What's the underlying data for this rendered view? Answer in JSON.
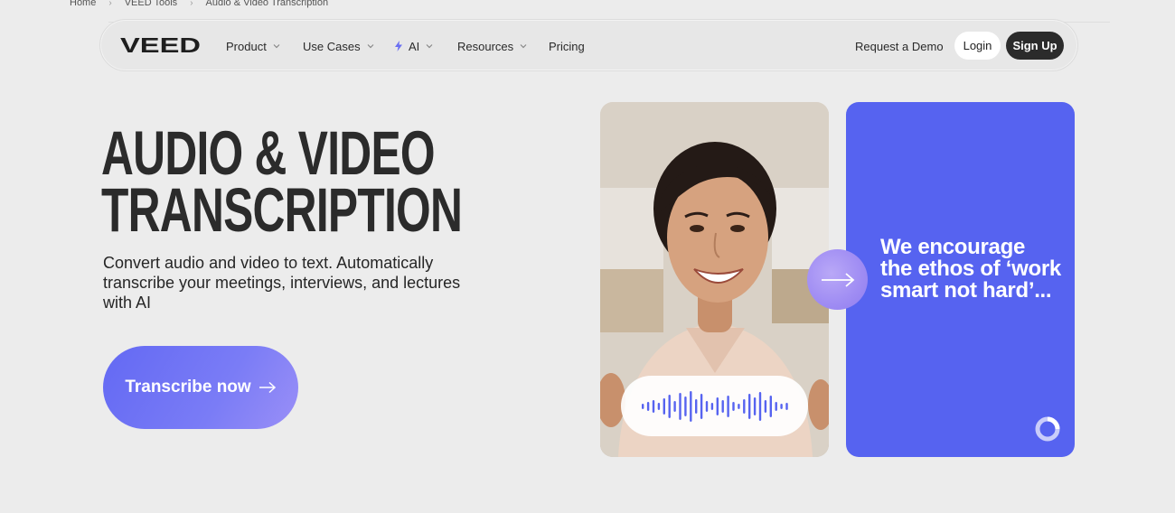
{
  "breadcrumb": {
    "items": [
      "Home",
      "VEED Tools",
      "Audio & Video Transcription"
    ]
  },
  "nav": {
    "logo_text": "VEED",
    "items": [
      {
        "label": "Product",
        "has_dropdown": true
      },
      {
        "label": "Use Cases",
        "has_dropdown": true
      },
      {
        "label": "AI",
        "has_dropdown": true,
        "icon": "lightning-icon"
      },
      {
        "label": "Resources",
        "has_dropdown": true
      },
      {
        "label": "Pricing",
        "has_dropdown": false
      }
    ],
    "request_demo": "Request a Demo",
    "login": "Login",
    "signup": "Sign Up"
  },
  "hero": {
    "title_line1": "AUDIO & VIDEO",
    "title_line2": "TRANSCRIPTION",
    "subtitle": "Convert audio and video to text. Automatically transcribe your meetings, interviews, and lectures with AI",
    "cta_label": "Transcribe now"
  },
  "quote": {
    "text": "We encourage the ethos of ‘work smart not hard’..."
  },
  "colors": {
    "accent": "#5663f0",
    "cta_gradient_start": "#6369f3",
    "dark": "#2b2b2b",
    "background": "#ececec"
  }
}
